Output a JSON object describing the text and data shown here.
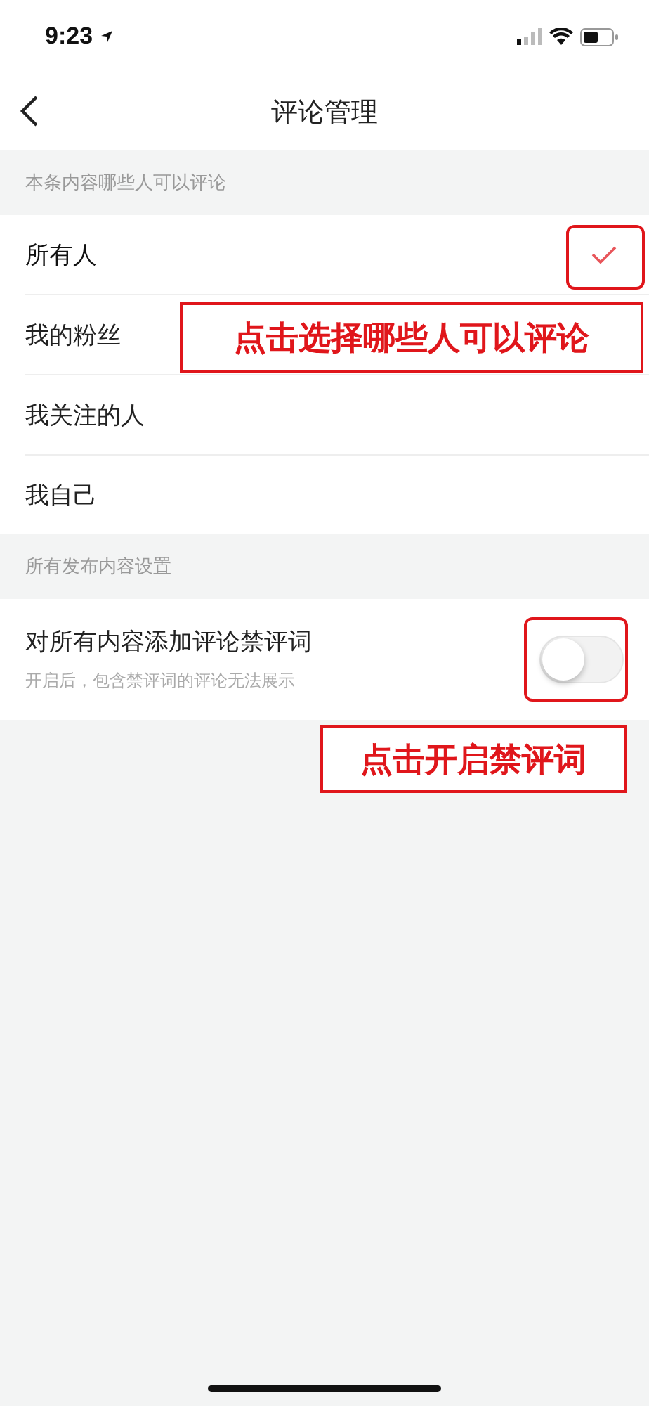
{
  "status_bar": {
    "time": "9:23"
  },
  "nav": {
    "title": "评论管理"
  },
  "audience": {
    "header": "本条内容哪些人可以评论",
    "options": [
      {
        "label": "所有人",
        "selected": true
      },
      {
        "label": "我的粉丝",
        "selected": false
      },
      {
        "label": "我关注的人",
        "selected": false
      },
      {
        "label": "我自己",
        "selected": false
      }
    ]
  },
  "settings": {
    "header": "所有发布内容设置",
    "toggle": {
      "label": "对所有内容添加评论禁评词",
      "hint": "开启后，包含禁评词的评论无法展示",
      "on": false
    }
  },
  "annotations": [
    {
      "text": "点击选择哪些人可以评论"
    },
    {
      "text": "点击开启禁评词"
    }
  ]
}
